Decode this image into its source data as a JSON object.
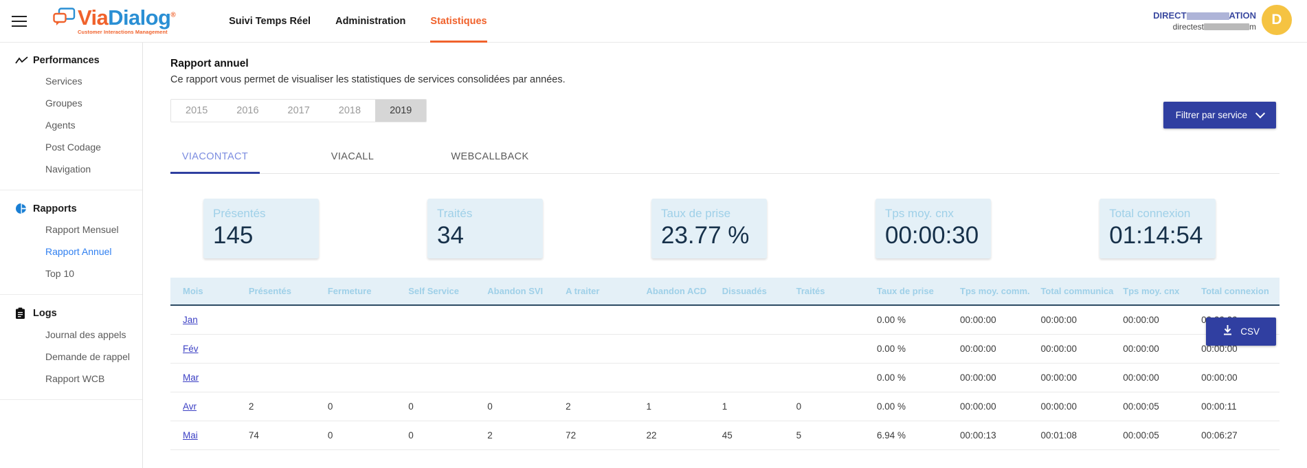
{
  "header": {
    "menu_icon": "hamburger-icon",
    "logo": {
      "part1": "Via",
      "part2": "Dialog",
      "registered": "®",
      "tagline": "Customer Interactions Management"
    },
    "nav": [
      {
        "label": "Suivi Temps Réel",
        "active": false
      },
      {
        "label": "Administration",
        "active": false
      },
      {
        "label": "Statistiques",
        "active": true
      }
    ],
    "user": {
      "name_prefix": "DIRECT",
      "name_suffix": "ATION",
      "mail_prefix": "directest",
      "mail_suffix": "m",
      "avatar_initial": "D"
    }
  },
  "sidebar": {
    "groups": [
      {
        "title": "Performances",
        "icon": "trend-line-icon",
        "items": [
          {
            "label": "Services",
            "active": false
          },
          {
            "label": "Groupes",
            "active": false
          },
          {
            "label": "Agents",
            "active": false
          },
          {
            "label": "Post Codage",
            "active": false
          },
          {
            "label": "Navigation",
            "active": false
          }
        ]
      },
      {
        "title": "Rapports",
        "icon": "pie-chart-icon",
        "items": [
          {
            "label": "Rapport Mensuel",
            "active": false
          },
          {
            "label": "Rapport Annuel",
            "active": true
          },
          {
            "label": "Top 10",
            "active": false
          }
        ]
      },
      {
        "title": "Logs",
        "icon": "clipboard-icon",
        "items": [
          {
            "label": "Journal des appels",
            "active": false
          },
          {
            "label": "Demande de rappel",
            "active": false
          },
          {
            "label": "Rapport WCB",
            "active": false
          }
        ]
      }
    ]
  },
  "main": {
    "title": "Rapport annuel",
    "subtitle": "Ce rapport vous permet de visualiser les statistiques de services consolidées par années.",
    "years": [
      {
        "label": "2015",
        "active": false
      },
      {
        "label": "2016",
        "active": false
      },
      {
        "label": "2017",
        "active": false
      },
      {
        "label": "2018",
        "active": false
      },
      {
        "label": "2019",
        "active": true
      }
    ],
    "filter_button": "Filtrer par service",
    "tabs": [
      {
        "label": "VIACONTACT",
        "active": true
      },
      {
        "label": "VIACALL",
        "active": false
      },
      {
        "label": "WEBCALLBACK",
        "active": false
      }
    ],
    "kpis": [
      {
        "label": "Présentés",
        "value": "145"
      },
      {
        "label": "Traités",
        "value": "34"
      },
      {
        "label": "Taux de prise",
        "value": "23.77 %"
      },
      {
        "label": "Tps moy. cnx",
        "value": "00:00:30"
      },
      {
        "label": "Total connexion",
        "value": "01:14:54"
      }
    ],
    "csv_button": "CSV",
    "table": {
      "columns": [
        "Mois",
        "Présentés",
        "Fermeture",
        "Self Service",
        "Abandon SVI",
        "A traiter",
        "Abandon ACD",
        "Dissuadés",
        "Traités",
        "Taux de prise",
        "Tps moy. comm.",
        "Total communica",
        "Tps moy. cnx",
        "Total connexion"
      ],
      "rows": [
        {
          "mois": "Jan",
          "cells": [
            "",
            "",
            "",
            "",
            "",
            "",
            "",
            "",
            "0.00 %",
            "00:00:00",
            "00:00:00",
            "00:00:00",
            "00:00:00"
          ]
        },
        {
          "mois": "Fév",
          "cells": [
            "",
            "",
            "",
            "",
            "",
            "",
            "",
            "",
            "0.00 %",
            "00:00:00",
            "00:00:00",
            "00:00:00",
            "00:00:00"
          ]
        },
        {
          "mois": "Mar",
          "cells": [
            "",
            "",
            "",
            "",
            "",
            "",
            "",
            "",
            "0.00 %",
            "00:00:00",
            "00:00:00",
            "00:00:00",
            "00:00:00"
          ]
        },
        {
          "mois": "Avr",
          "cells": [
            "2",
            "0",
            "0",
            "0",
            "2",
            "1",
            "1",
            "0",
            "0.00 %",
            "00:00:00",
            "00:00:00",
            "00:00:05",
            "00:00:11"
          ]
        },
        {
          "mois": "Mai",
          "cells": [
            "74",
            "0",
            "0",
            "2",
            "72",
            "22",
            "45",
            "5",
            "6.94 %",
            "00:00:13",
            "00:01:08",
            "00:00:05",
            "00:06:27"
          ]
        }
      ]
    }
  },
  "colors": {
    "brand_orange": "#f0622c",
    "brand_blue": "#2a8fd4",
    "accent_indigo": "#303fa1",
    "kpi_bg": "#e4f0f7",
    "kpi_label": "#9fd0e8",
    "kpi_value": "#17314a",
    "avatar_yellow": "#f5c342"
  }
}
